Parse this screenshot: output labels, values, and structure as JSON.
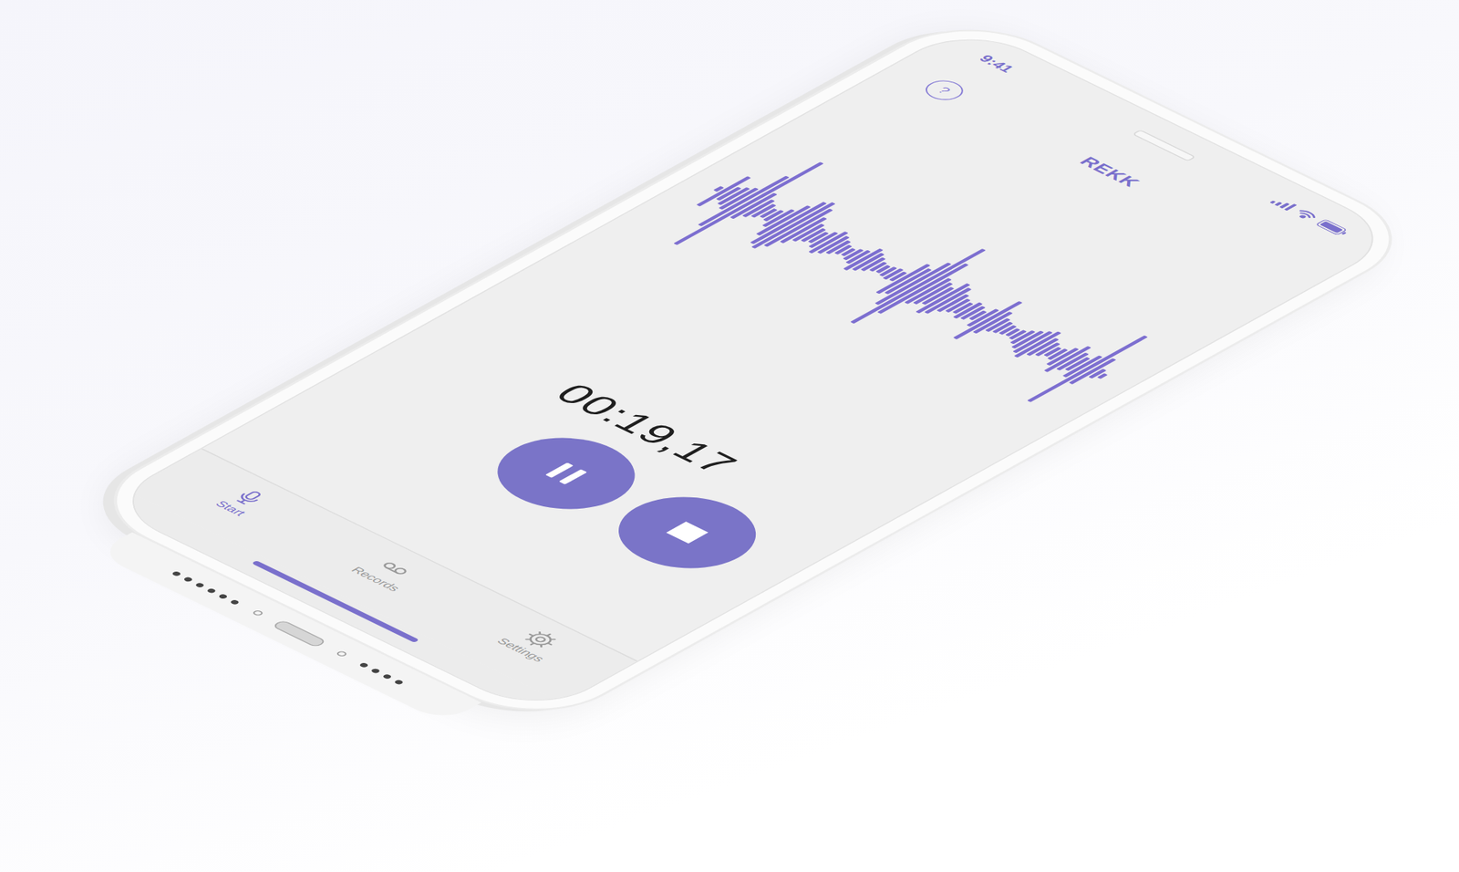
{
  "status_bar": {
    "time": "9:41"
  },
  "header": {
    "help": "?",
    "title": "REKK"
  },
  "waveform": [
    0.05,
    0.35,
    0.15,
    0.2,
    0.25,
    0.6,
    1.0,
    0.3,
    0.2,
    0.15,
    0.1,
    0.12,
    0.2,
    0.35,
    0.5,
    0.55,
    0.45,
    0.3,
    0.2,
    0.15,
    0.12,
    0.18,
    0.25,
    0.2,
    0.15,
    0.1,
    0.08,
    0.12,
    0.15,
    0.25,
    0.2,
    0.15,
    0.1,
    0.08,
    0.1,
    0.12,
    0.1,
    0.35,
    0.3,
    0.5,
    0.9,
    0.6,
    0.3,
    0.25,
    0.2,
    0.35,
    0.3,
    0.2,
    0.15,
    0.12,
    0.18,
    0.15,
    0.1,
    0.2,
    0.45,
    0.25,
    0.15,
    0.12,
    0.1,
    0.08,
    0.1,
    0.15,
    0.2,
    0.25,
    0.3,
    0.2,
    0.15,
    0.1,
    0.12,
    0.2,
    0.3,
    0.2,
    0.15,
    0.25,
    0.8,
    0.3,
    0.1,
    0.05
  ],
  "timer": "00:19,17",
  "tabs": [
    {
      "label": "Start",
      "selected": true
    },
    {
      "label": "Records",
      "selected": false
    },
    {
      "label": "Settings",
      "selected": false
    }
  ]
}
